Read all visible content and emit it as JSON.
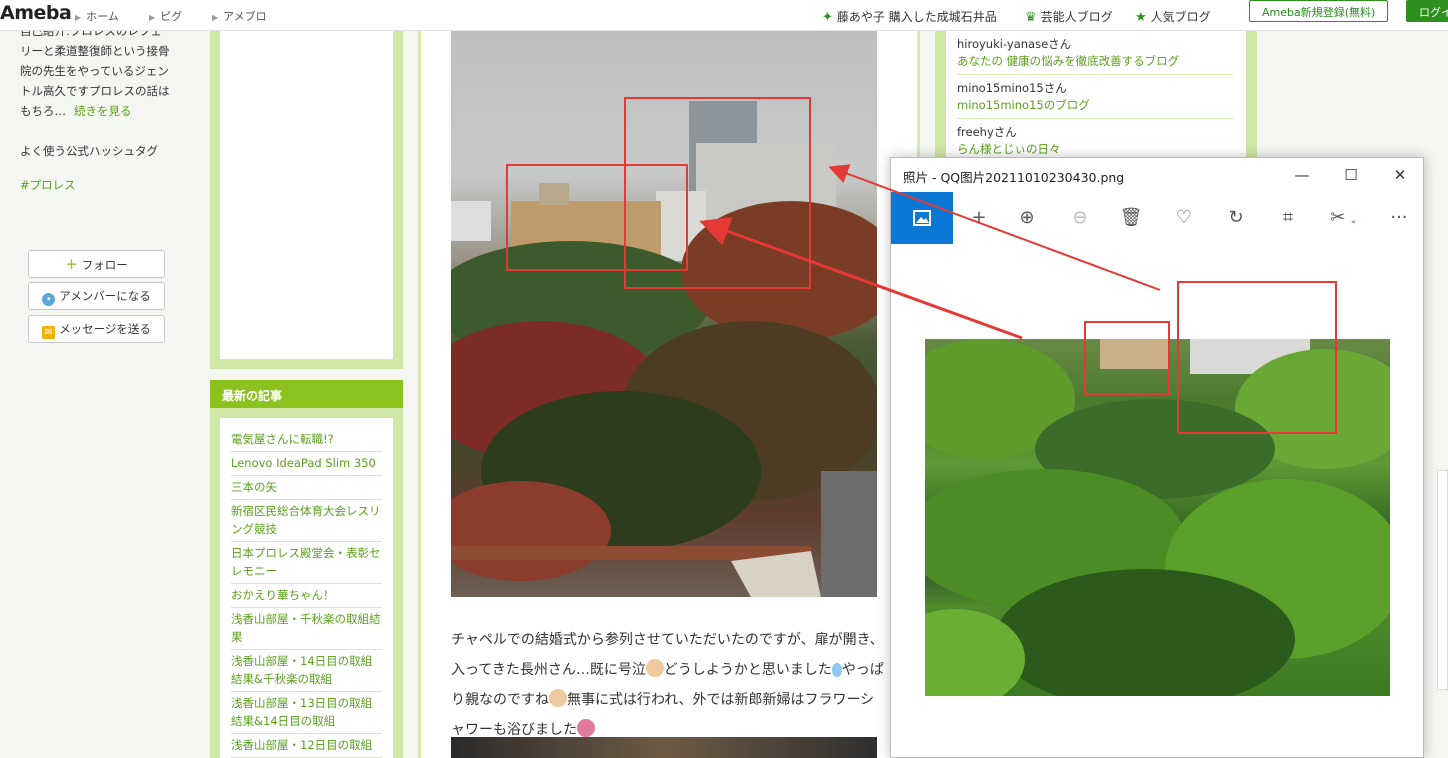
{
  "header": {
    "logo": "Ameba",
    "nav": [
      "ホーム",
      "ピグ",
      "アメブロ"
    ],
    "links": [
      {
        "icon": "plus-star-icon",
        "label": "藤あや子 購入した成城石井品"
      },
      {
        "icon": "crown-icon",
        "label": "芸能人ブログ"
      },
      {
        "icon": "star-icon",
        "label": "人気ブログ"
      }
    ],
    "register_label": "Ameba新規登録(無料)",
    "login_label": "ログイ"
  },
  "sidebar": {
    "intro": "自己紹介:プロレスのレフェリーと柔道整復師という接骨院の先生をやっているジェントル高久ですプロレスの話はもちろ…",
    "more": "続きを見る",
    "hashtag_label": "よく使う公式ハッシュタグ",
    "hashtag": "#プロレス",
    "follow_label": "フォロー",
    "member_label": "アメンバーになる",
    "message_label": "メッセージを送る",
    "recent_title": "最新の記事",
    "recent": [
      "電気屋さんに転職!?",
      "Lenovo IdeaPad Slim 350",
      "三本の矢",
      "新宿区民総合体育大会レスリング競技",
      "日本プロレス殿堂会・表彰セレモニー",
      "おかえり華ちゃん！",
      "浅香山部屋・千秋楽の取組結果",
      "浅香山部屋・14日目の取組結果&千秋楽の取組",
      "浅香山部屋・13日目の取組結果&14日目の取組",
      "浅香山部屋・12日目の取組"
    ]
  },
  "article": {
    "para_1": "チャペルでの結婚式から参列させていただいたのですが、扉が開き、入ってきた長州さん…既に号泣",
    "para_2": "どうしようかと思いました",
    "para_3": "やっぱり親なのですね",
    "para_4": "無事に式は行われ、外では新郎新婦はフラワーシャワーも浴びました"
  },
  "readers": [
    {
      "name": "hiroyuki-yanaseさん",
      "blog": "あなたの 健康の悩みを徹底改善するブログ"
    },
    {
      "name": "mino15mino15さん",
      "blog": "mino15mino15のブログ"
    },
    {
      "name": "freehyさん",
      "blog": "らん様とじぃの日々"
    }
  ],
  "viewer": {
    "title": "照片 - QQ图片20211010230430.png",
    "minimize": "—",
    "maximize": "☐",
    "close": "✕",
    "more": "···"
  },
  "colors": {
    "accent": "#2d8f1c",
    "annotation": "#e53935",
    "windows_blue": "#0a78d4"
  }
}
